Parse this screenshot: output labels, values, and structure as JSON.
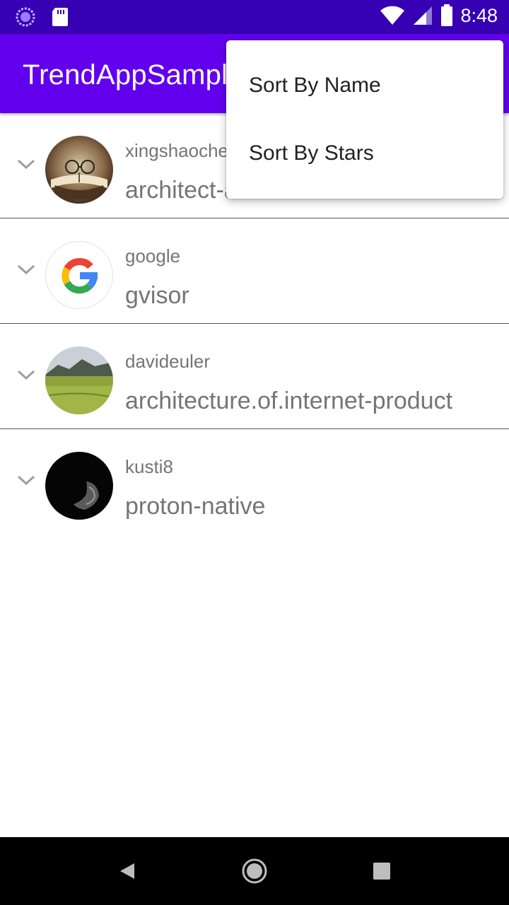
{
  "status_bar": {
    "time": "8:48",
    "icons": [
      "loading-circle-icon",
      "sd-card-icon",
      "wifi-icon",
      "signal-icon",
      "battery-icon"
    ]
  },
  "app_bar": {
    "title": "TrendAppSample",
    "color": "#6200ee",
    "status_color": "#3700b3"
  },
  "overflow_menu": {
    "items": [
      {
        "label": "Sort By Name"
      },
      {
        "label": "Sort By Stars"
      }
    ]
  },
  "repos": [
    {
      "owner": "xingshaocheng",
      "name": "architect-awesome",
      "avatar": "book-glasses-avatar"
    },
    {
      "owner": "google",
      "name": "gvisor",
      "avatar": "google-g-avatar"
    },
    {
      "owner": "davideuler",
      "name": "architecture.of.internet-product",
      "avatar": "landscape-avatar"
    },
    {
      "owner": "kusti8",
      "name": "proton-native",
      "avatar": "dark-portrait-avatar"
    }
  ],
  "nav_bar": {
    "icons": [
      "back-icon",
      "home-icon",
      "recents-icon"
    ]
  }
}
